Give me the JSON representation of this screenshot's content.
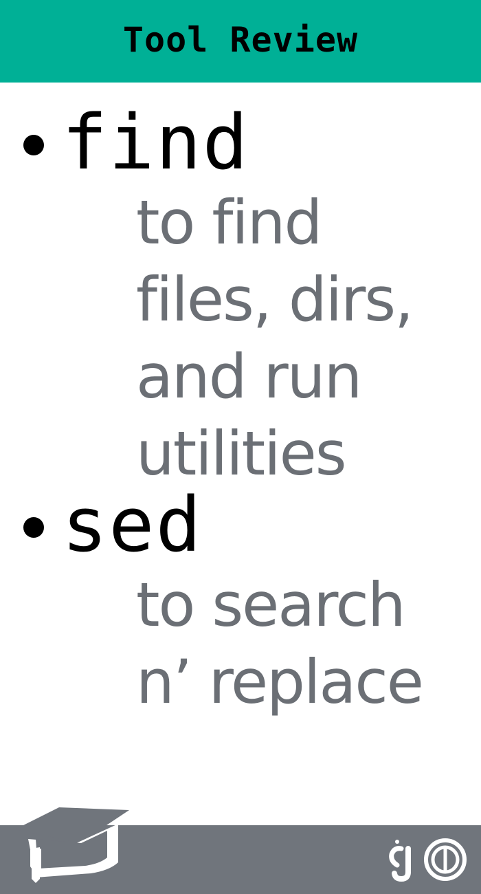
{
  "header": {
    "title": "Tool Review"
  },
  "tools": [
    {
      "name": "find",
      "description_lines": [
        "to find",
        "files, dirs,",
        "and run",
        "utilities"
      ]
    },
    {
      "name": "sed",
      "description_lines": [
        "to search",
        "n’ replace"
      ]
    }
  ],
  "footer": {
    "left_icon": "graduation-cap-icon",
    "right_logo": "brand-logo"
  },
  "colors": {
    "header_bg": "#00b096",
    "footer_bg": "#70757c",
    "description_text": "#6b6f75",
    "tool_text": "#000000"
  }
}
